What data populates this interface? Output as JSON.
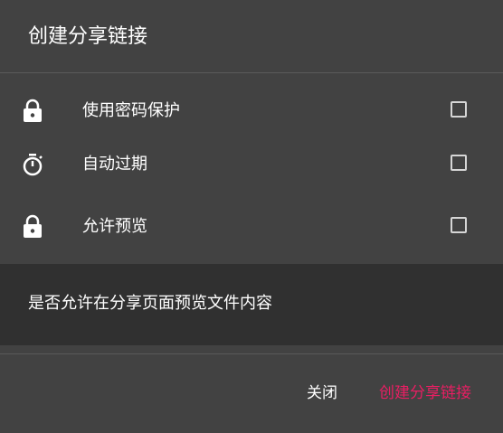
{
  "dialog": {
    "title": "创建分享链接",
    "options": [
      {
        "label": "使用密码保护",
        "icon": "lock-icon",
        "checked": false
      },
      {
        "label": "自动过期",
        "icon": "stopwatch-icon",
        "checked": false
      },
      {
        "label": "允许预览",
        "icon": "lock-icon",
        "checked": false
      }
    ],
    "help_text": "是否允许在分享页面预览文件内容",
    "close_label": "关闭",
    "create_label": "创建分享链接"
  },
  "colors": {
    "background": "#424242",
    "help_panel": "#303030",
    "accent": "#e91e63",
    "text": "#ffffff"
  }
}
